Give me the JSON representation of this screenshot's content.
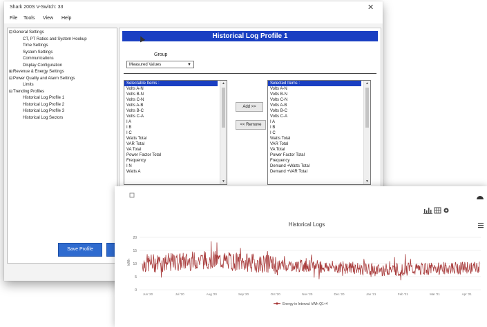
{
  "window": {
    "title": "Shark 200S V-Switch: 33",
    "close_glyph": "✕"
  },
  "menu": [
    "File",
    "Tools",
    "View",
    "Help"
  ],
  "tree": [
    {
      "label": "General Settings",
      "level": 0,
      "expander": "⊟"
    },
    {
      "label": "CT, PT Ratios and System Hookup",
      "level": 1
    },
    {
      "label": "Time Settings",
      "level": 1
    },
    {
      "label": "System Settings",
      "level": 1
    },
    {
      "label": "Communications",
      "level": 1
    },
    {
      "label": "Display Configuration",
      "level": 1
    },
    {
      "label": "Revenue & Energy Settings",
      "level": 0,
      "expander": "⊞"
    },
    {
      "label": "Power Quality and Alarm Settings",
      "level": 0,
      "expander": "⊟"
    },
    {
      "label": "Limits",
      "level": 1
    },
    {
      "label": "Trending Profiles",
      "level": 0,
      "expander": "⊟"
    },
    {
      "label": "Historical Log Profile 1",
      "level": 1
    },
    {
      "label": "Historical Log Profile 2",
      "level": 1
    },
    {
      "label": "Historical Log Profile 3",
      "level": 1
    },
    {
      "label": "Historical Log Sectors",
      "level": 1
    }
  ],
  "panel": {
    "title": "Historical Log Profile 1",
    "group_label": "Group",
    "group_value": "Measured Values",
    "add_label": "Add >>",
    "remove_label": "<< Remove"
  },
  "selectable_items": [
    "Selectable Items :",
    "Volts A-N",
    "Volts B-N",
    "Volts C-N",
    "Volts A-B",
    "Volts B-C",
    "Volts C-A",
    "I A",
    "I B",
    "I C",
    "Watts Total",
    "VAR Total",
    "VA Total",
    "Power Factor Total",
    "Frequency",
    "I N",
    "Watts A"
  ],
  "selected_items": [
    "Selected Items :",
    "Volts A-N",
    "Volts B-N",
    "Volts C-N",
    "Volts A-B",
    "Volts B-C",
    "Volts C-A",
    "I A",
    "I B",
    "I C",
    "Watts Total",
    "VAR Total",
    "VA Total",
    "Power Factor Total",
    "Frequency",
    "Demand +Watts Total",
    "Demand +VAR Total"
  ],
  "buttons": {
    "save_profile": "Save Profile"
  },
  "chart_card": {
    "icons": [
      "bar-chart-icon",
      "table-icon",
      "gear-icon",
      "dashboard-icon",
      "hamburger-menu-icon"
    ],
    "accent_color": "#a83b3b"
  },
  "chart_data": {
    "type": "line",
    "title": "Historical Logs",
    "ylabel": "kWh",
    "ylim": [
      0,
      20
    ],
    "yticks": [
      0,
      5,
      10,
      15,
      20
    ],
    "x": [
      "Jun '20",
      "Jul '20",
      "Aug '20",
      "Sep '20",
      "Oct '20",
      "Nov '20",
      "Dec '20",
      "Jan '21",
      "Feb '21",
      "Mar '21",
      "Apr '21"
    ],
    "series": [
      {
        "name": "Energy in Interval: kWh Q1+4",
        "color": "#a83b3b",
        "values": [
          10,
          10.5,
          11.5,
          10.5,
          9.5,
          9,
          8.5,
          7.5,
          7.8,
          8.2,
          8.5
        ]
      }
    ]
  }
}
